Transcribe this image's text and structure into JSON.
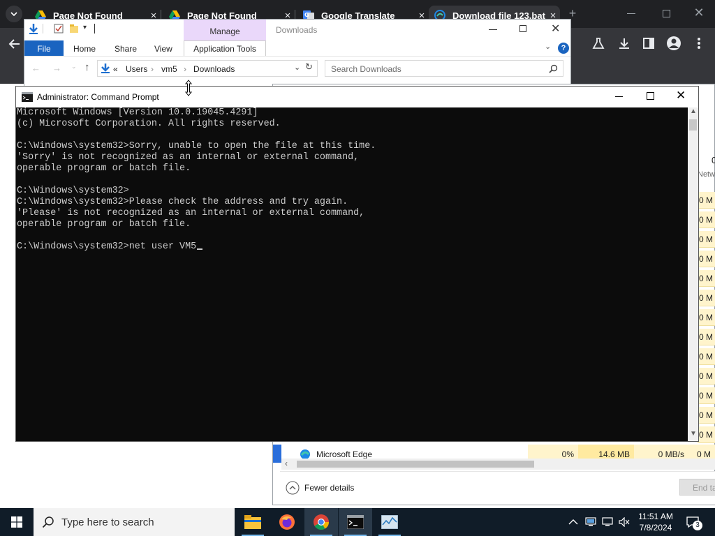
{
  "chrome": {
    "tabs": [
      {
        "label": "Page Not Found",
        "icon": "google-drive-icon"
      },
      {
        "label": "Page Not Found",
        "icon": "google-drive-icon"
      },
      {
        "label": "Google Translate",
        "icon": "google-translate-icon"
      },
      {
        "label": "Download file 123.bat",
        "icon": "edge-icon"
      }
    ],
    "close_glyph": "×",
    "new_tab_glyph": "+"
  },
  "explorer": {
    "contextual_group": "Manage",
    "window_title": "Downloads",
    "ribbon_tabs": [
      "File",
      "Home",
      "Share",
      "View",
      "Application Tools"
    ],
    "breadcrumb": [
      "«",
      "Users",
      "vm5",
      "Downloads"
    ],
    "search_placeholder": "Search Downloads"
  },
  "cmd": {
    "title": "Administrator: Command Prompt",
    "lines": [
      "Microsoft Windows [Version 10.0.19045.4291]",
      "(c) Microsoft Corporation. All rights reserved.",
      "",
      "C:\\Windows\\system32>Sorry, unable to open the file at this time.",
      "'Sorry' is not recognized as an internal or external command,",
      "operable program or batch file.",
      "",
      "C:\\Windows\\system32>",
      "C:\\Windows\\system32>Please check the address and try again.",
      "'Please' is not recognized as an internal or external command,",
      "operable program or batch file.",
      "",
      "C:\\Windows\\system32>net user VM5"
    ]
  },
  "taskmgr": {
    "row_app_name": "Microsoft Edge",
    "row_cpu": "0%",
    "row_memory": "14.6 MB",
    "row_disk": "0 MB/s",
    "row_network": "0 M",
    "column_partial_header": "Netw",
    "column_partial_digit": "0",
    "mem_column_values": [
      "0 M",
      "0 M",
      "0 M",
      "0 M",
      "0 M",
      "0 M",
      "0 M",
      "0 M",
      "0 M",
      "0 M",
      "0 M",
      "0 M",
      "0 M"
    ],
    "fewer_details": "Fewer details",
    "end_task": "End ta"
  },
  "taskbar": {
    "search_placeholder": "Type here to search",
    "time": "11:51 AM",
    "date": "7/8/2024",
    "notification_count": "3"
  }
}
